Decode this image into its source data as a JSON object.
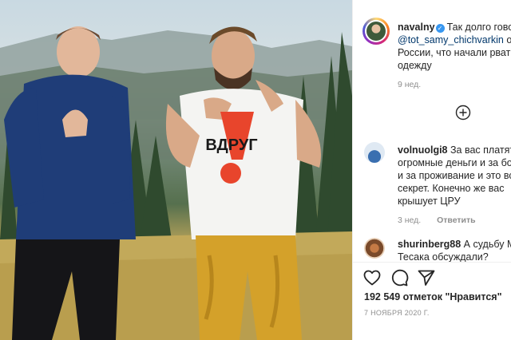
{
  "post": {
    "author": "navalny",
    "caption_text": "Так долго говор",
    "caption_mention": "@tot_samy_chichvarkin",
    "caption_tail": " о су",
    "caption_line2": "России, что начали рвать",
    "caption_line3": "одежду",
    "caption_age": "9 нед.",
    "shirt_text": "ВДРУГ",
    "likes": "192 549 отметок \"Нравится\"",
    "date": "7 НОЯБРЯ 2020 Г."
  },
  "comments": [
    {
      "user": "volnuolgi8",
      "text_l1": "За вас платят та",
      "text_l2": "огромные деньги и за бол",
      "text_l3": "и за проживание и это все",
      "text_l4": "секрет. Конечно же вас",
      "text_l5": "крышует ЦРУ",
      "age": "3 нед.",
      "reply": "Ответить"
    },
    {
      "user": "shurinberg88",
      "text_l1": " А судьбу Ма",
      "text_l2": "Тесака обсуждали?"
    }
  ],
  "icons": {
    "load_more": "plus-circle-icon",
    "like": "heart-icon",
    "comment": "comment-bubble-icon",
    "share": "paper-plane-icon",
    "verified": "verified-badge-icon"
  },
  "colors": {
    "mention": "#00376b",
    "verified": "#3897f0",
    "meta": "#8e8e8e",
    "shirt_accent": "#e8452c",
    "trousers": "#d4a12a",
    "hoodie": "#1f3d78"
  }
}
